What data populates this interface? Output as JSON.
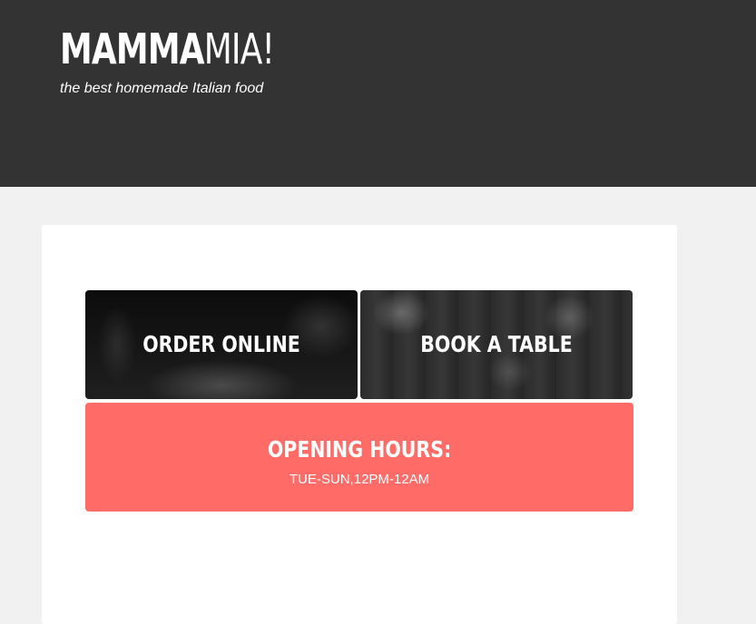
{
  "header": {
    "logo_bold": "MAMMA",
    "logo_light": "MIA!",
    "tagline": "the best homemade Italian food"
  },
  "actions": {
    "order_label": "ORDER ONLINE",
    "book_label": "BOOK A TABLE"
  },
  "hours": {
    "title": "OPENING HOURS:",
    "text": "TUE-SUN,12PM-12AM"
  },
  "colors": {
    "header_bg": "#333333",
    "page_bg": "#f1f1f1",
    "card_bg": "#ffffff",
    "hours_bg": "#ff6b66"
  }
}
